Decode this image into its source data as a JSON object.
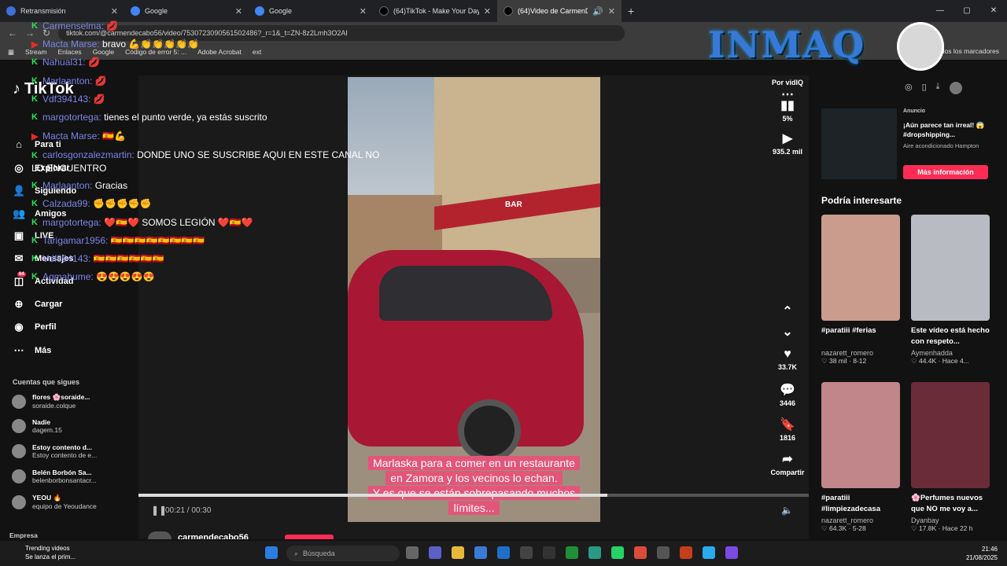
{
  "tabs": [
    {
      "label": "Retransmisión",
      "color": "#3f6fd8"
    },
    {
      "label": "Google",
      "color": "#4285f4"
    },
    {
      "label": "Google",
      "color": "#4285f4"
    },
    {
      "label": "(64)TikTok - Make Your Day",
      "color": "#222"
    },
    {
      "label": "(64)Video de CarmenDC (@",
      "color": "#222"
    }
  ],
  "address": {
    "url": "tiktok.com/@carmendecabo56/video/7530723090561502486?_r=1&_t=ZN-8z2Lmh3O2AI"
  },
  "bookmarks": [
    "Stream",
    "Enlaces",
    "Google",
    "Código de error 5: ...",
    "Adobe Acrobat",
    "ext"
  ],
  "bookmarks_right": "Todos los marcadores",
  "sidebar": {
    "logo": "TikTok",
    "items": [
      {
        "label": "Para ti",
        "icon": "home-icon"
      },
      {
        "label": "Explorar",
        "icon": "compass-icon"
      },
      {
        "label": "Siguiendo",
        "icon": "following-icon"
      },
      {
        "label": "Amigos",
        "icon": "friends-icon"
      },
      {
        "label": "LIVE",
        "icon": "live-icon"
      },
      {
        "label": "Mensajes",
        "icon": "messages-icon"
      },
      {
        "label": "Actividad",
        "icon": "activity-icon"
      },
      {
        "label": "Cargar",
        "icon": "upload-icon"
      },
      {
        "label": "Perfil",
        "icon": "profile-icon"
      },
      {
        "label": "Más",
        "icon": "more-icon"
      }
    ],
    "activity_badge": "64",
    "follow_heading": "Cuentas que sigues",
    "following": [
      {
        "name": "flores 🌸soraide...",
        "user": "soraide.colque"
      },
      {
        "name": "Nadie",
        "user": "dagem.15"
      },
      {
        "name": "Estoy contento d...",
        "user": "Estoy contento de e..."
      },
      {
        "name": "Belén Borbón Sa...",
        "user": "belenborbonsantacr..."
      },
      {
        "name": "YEOU 🔥",
        "user": "equipo de Yeoudance"
      }
    ],
    "footer": "Empresa"
  },
  "video": {
    "caption": [
      "Marlaska para a comer en un restaurante",
      "en Zamora y los vecinos lo echan.",
      "Y es que se están sobrepasando muchos",
      "límites..."
    ],
    "bar_sign": "BAR",
    "time": "00:21 / 00:30",
    "progress": 0.7,
    "author": "carmendecabo56"
  },
  "actions": {
    "by": "Por vidIQ",
    "percent": "5%",
    "views": "935.2 mil",
    "likes": "33.7K",
    "comments": "3446",
    "saves": "1816",
    "share": "Compartir"
  },
  "ad": {
    "label": "Anuncio",
    "title": "¡Aún parece tan irreal! 😱 #dropshipping...",
    "sub": "Aire acondicionado Hampton",
    "button": "Más información"
  },
  "interest": {
    "heading": "Podría interesarte",
    "cards": [
      {
        "title": "#paratiii #ferias",
        "author": "nazarett_romero",
        "stats": "♡ 38 mil · 8-12",
        "color": "#c99c8e"
      },
      {
        "title": "Este vídeo está hecho con respeto...",
        "author": "Aymenhadda",
        "stats": "♡ 44.4K · Hace 4...",
        "color": "#b8bcc2"
      },
      {
        "title": "#paratiii #limpiezadecasa",
        "author": "nazarett_romero",
        "stats": "♡ 64.3K · 5-28",
        "color": "#c1868a"
      },
      {
        "title": "🌸Perfumes nuevos que NO me voy a...",
        "author": "Dyanbay",
        "stats": "♡ 17.8K · Hace 22 h",
        "color": "#6b2c3a"
      }
    ]
  },
  "overlay_logo": "INMAQ",
  "chat": [
    {
      "user": "Carmenselma:",
      "text": "💋"
    },
    {
      "user": "Macta Marse:",
      "text": "bravo 💪👏👏👏👏👏"
    },
    {
      "user": "Nahual31:",
      "text": "💋"
    },
    {
      "user": "Marlaanton:",
      "text": "💋"
    },
    {
      "user": "Vdf394143:",
      "text": "💋"
    },
    {
      "user": "margotortega:",
      "text": "tienes el punto verde, ya estás suscrito"
    },
    {
      "user": "Macta Marse:",
      "text": "🇪🇸💪"
    },
    {
      "user": "carlosgonzalezmartin:",
      "text": "DONDE UNO SE SUSCRIBE AQUI EN ESTE CANAL NO LO ENCUENTRO"
    },
    {
      "user": "Marlaanton:",
      "text": "Gracias"
    },
    {
      "user": "Calzada99:",
      "text": "✊✊✊✊✊"
    },
    {
      "user": "margotortega:",
      "text": "❤️🇪🇸❤️ SOMOS LEGIÓN ❤️🇪🇸❤️"
    },
    {
      "user": "Tarigamar1956:",
      "text": "🇪🇸🇪🇸🇪🇸🇪🇸🇪🇸🇪🇸🇪🇸🇪🇸"
    },
    {
      "user": "Vdf394143:",
      "text": "🇪🇸🇪🇸🇪🇸🇪🇸🇪🇸🇪🇸"
    },
    {
      "user": "Agmahume:",
      "text": "😍😍😍😍😍"
    }
  ],
  "taskbar": {
    "news_title": "Trending videos",
    "news_sub": "Se lanza el prim...",
    "search": "Búsqueda",
    "time": "21:46",
    "date": "21/08/2025"
  }
}
